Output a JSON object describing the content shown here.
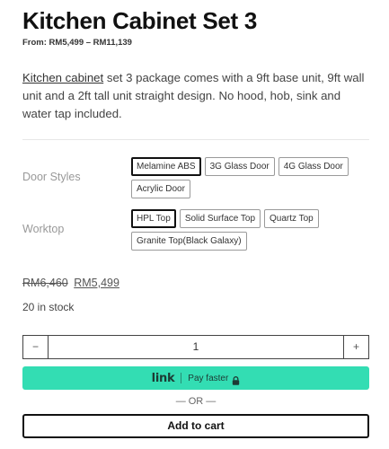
{
  "product": {
    "title": "Kitchen Cabinet Set 3",
    "price_range": "From: RM5,499 – RM11,139",
    "desc_link": "Kitchen cabinet",
    "desc_rest": " set 3 package comes with a 9ft base unit, 9ft wall unit and a 2ft tall unit straight design. No hood, hob, sink and water tap included."
  },
  "door_styles": {
    "label": "Door Styles",
    "options": [
      "Melamine ABS",
      "3G Glass Door",
      "4G Glass Door",
      "Acrylic Door"
    ],
    "selected": "Melamine ABS"
  },
  "worktop": {
    "label": "Worktop",
    "options": [
      "HPL Top",
      "Solid Surface Top",
      "Quartz Top",
      "Granite Top(Black Galaxy)"
    ],
    "selected": "HPL Top"
  },
  "pricing": {
    "old_price": "RM6,460",
    "new_price": "RM5,499",
    "stock": "20 in stock"
  },
  "quantity": {
    "minus": "−",
    "value": "1",
    "plus": "+"
  },
  "link_button": {
    "logo": "link",
    "label": "Pay faster",
    "icon": "lock-icon",
    "color": "#33ddb3"
  },
  "or_text": "— OR —",
  "add_to_cart": "Add to cart"
}
